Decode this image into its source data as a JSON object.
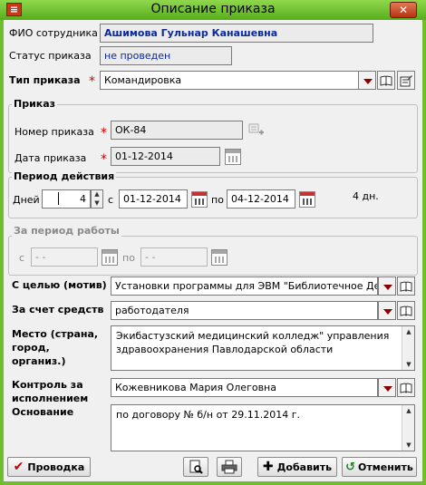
{
  "window": {
    "title": "Описание приказа",
    "close_glyph": "✕",
    "app_icon_glyph": "≡"
  },
  "employee": {
    "label": "ФИО сотрудника",
    "value": "Ашимова Гульнар Канашевна"
  },
  "status": {
    "label": "Статус приказа",
    "value": "не проведен"
  },
  "order_type": {
    "label": "Тип приказа",
    "value": "Командировка"
  },
  "order_group": {
    "title": "Приказ",
    "number_label": "Номер приказа",
    "number_value": "ОК-84",
    "date_label": "Дата приказа",
    "date_value": "01-12-2014"
  },
  "period": {
    "title": "Период действия",
    "days_label": "Дней",
    "days_value": "4",
    "from_label": "с",
    "from_value": "01-12-2014",
    "to_label": "по",
    "to_value": "04-12-2014",
    "total": "4 дн."
  },
  "work_period": {
    "title": "За период работы",
    "from_label": "с",
    "from_value": "- -",
    "to_label": "по",
    "to_value": "- -"
  },
  "purpose": {
    "label": "С целью (мотив)",
    "value": "Установки программы для ЭВМ \"Библиотечное Де"
  },
  "funding": {
    "label": "За счет средств",
    "value": "работодателя"
  },
  "place": {
    "label": "Место (страна, город, организ.)",
    "value": "Экибастузский медицинский колледж\" управления здравоохранения Павлодарской области"
  },
  "control": {
    "label": "Контроль за исполнением",
    "value": "Кожевникова Мария Олеговна"
  },
  "basis": {
    "label": "Основание",
    "value": "по договору № б/н от 29.11.2014 г."
  },
  "buttons": {
    "post": "Проводка",
    "add": "Добавить",
    "cancel": "Отменить"
  },
  "colors": {
    "titlebar": "#6fbe2e",
    "required": "#d40000",
    "employee_text": "#0a2a9a"
  }
}
